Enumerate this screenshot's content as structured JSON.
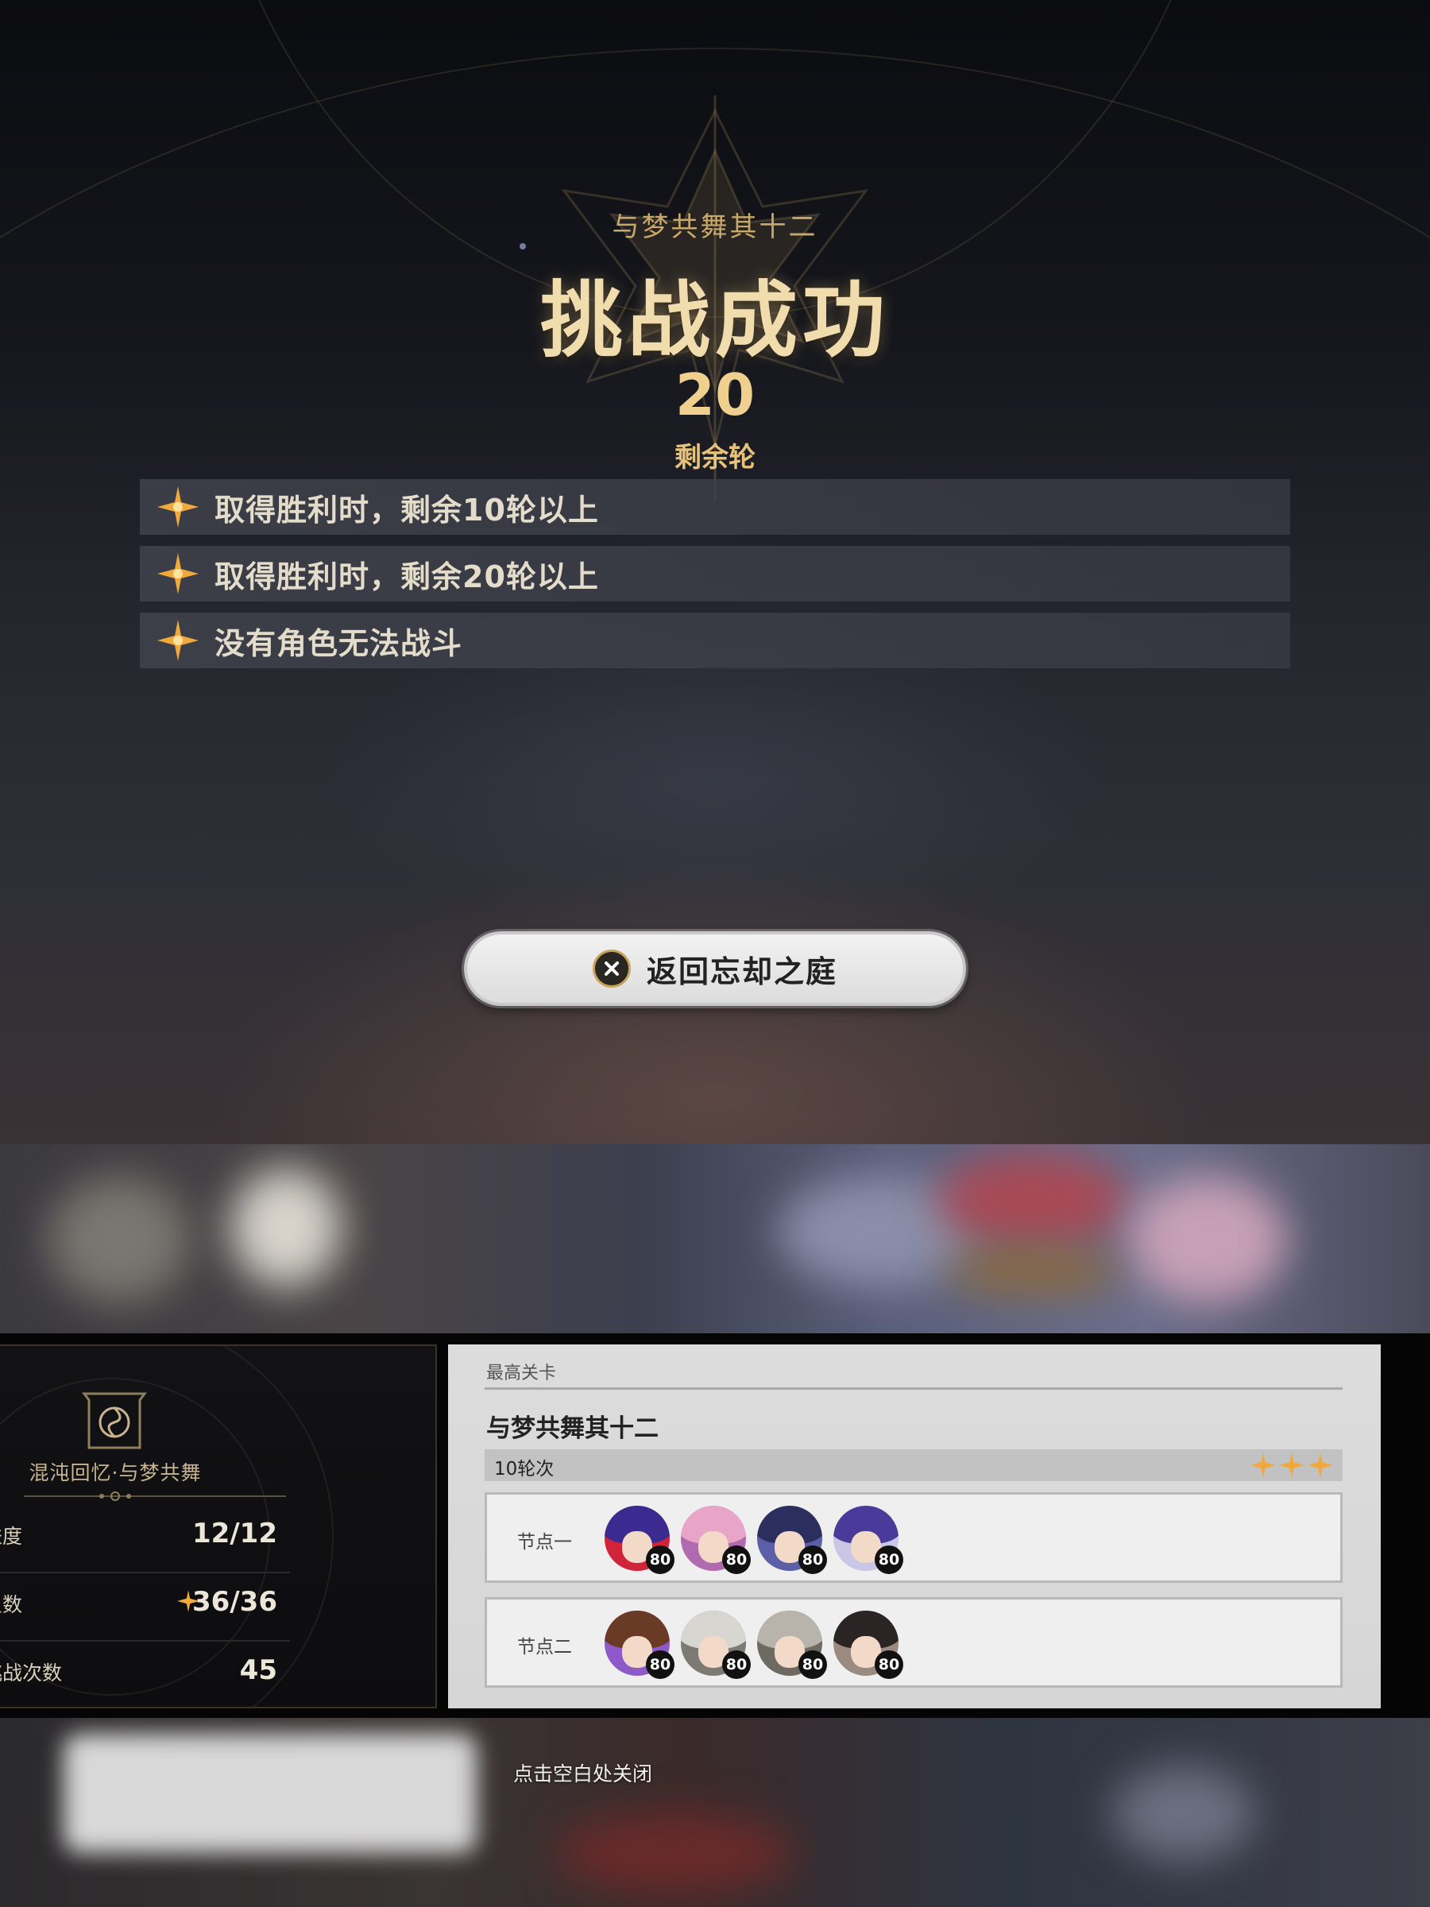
{
  "result": {
    "stage_name": "与梦共舞其十二",
    "title": "挑战成功",
    "rounds_remaining": "20",
    "rounds_remaining_label": "剩余轮",
    "objectives": [
      {
        "text": "取得胜利时，剩余10轮以上",
        "achieved": true
      },
      {
        "text": "取得胜利时，剩余20轮以上",
        "achieved": true
      },
      {
        "text": "没有角色无法战斗",
        "achieved": true
      }
    ],
    "return_button_label": "返回忘却之庭"
  },
  "summary": {
    "mode_title": "混沌回忆·与梦共舞",
    "stats": [
      {
        "name": "进度",
        "value": "12/12"
      },
      {
        "name": "星数",
        "value": "36/36"
      },
      {
        "name": "挑战次数",
        "value": "45"
      }
    ]
  },
  "record": {
    "header": "最高关卡",
    "stage_name": "与梦共舞其十二",
    "rounds": "10轮次",
    "stars": 3,
    "nodes": [
      {
        "label": "节点一",
        "characters": [
          {
            "level": "80",
            "hair": "#3b2a8f",
            "accent": "#d0243a"
          },
          {
            "level": "80",
            "hair": "#e9a5c7",
            "accent": "#b06ab0"
          },
          {
            "level": "80",
            "hair": "#2c2f5e",
            "accent": "#5b5fa8"
          },
          {
            "level": "80",
            "hair": "#4a3a9a",
            "accent": "#c9c6e6"
          }
        ]
      },
      {
        "label": "节点二",
        "characters": [
          {
            "level": "80",
            "hair": "#6a3b24",
            "accent": "#8e5ac9"
          },
          {
            "level": "80",
            "hair": "#d8d6d0",
            "accent": "#7d7a74"
          },
          {
            "level": "80",
            "hair": "#b8b4ac",
            "accent": "#6d6a62"
          },
          {
            "level": "80",
            "hair": "#2a2524",
            "accent": "#9a8a80"
          }
        ]
      }
    ]
  },
  "close_hint": "点击空白处关闭",
  "colors": {
    "gold": "#e7c27a",
    "star": "#f0a93a"
  }
}
